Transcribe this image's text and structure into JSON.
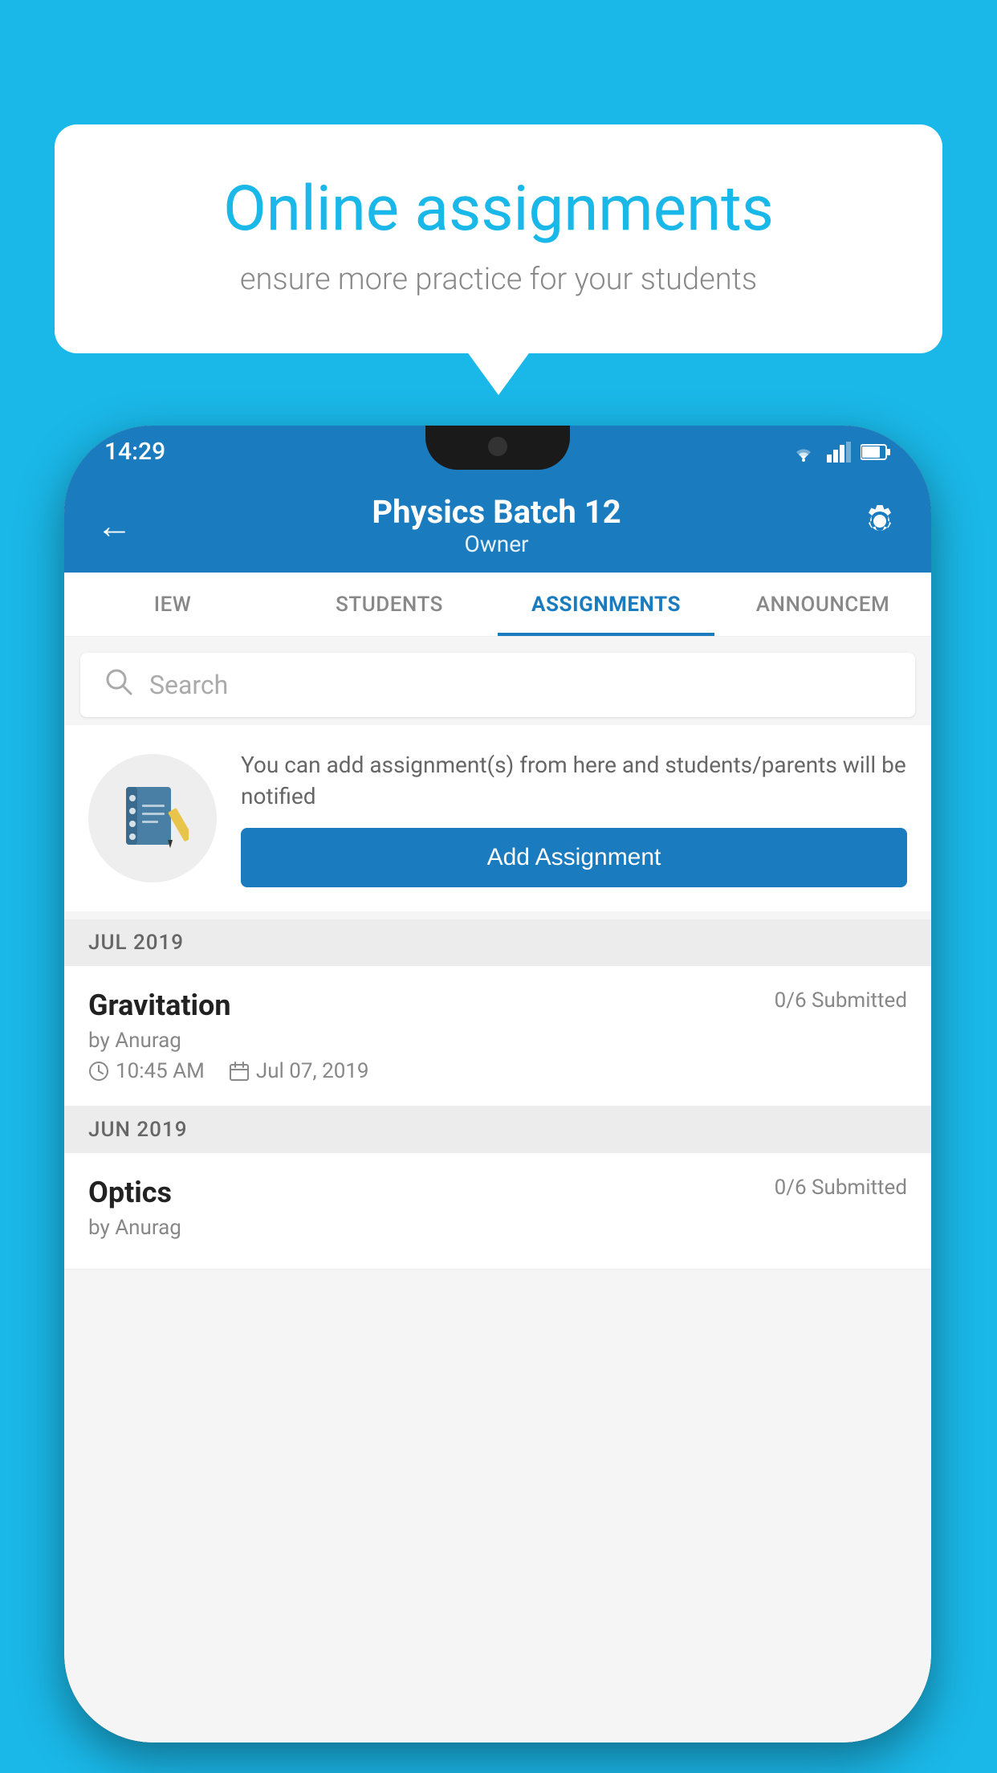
{
  "background_color": "#1ab8e8",
  "speech_bubble": {
    "title": "Online assignments",
    "subtitle": "ensure more practice for your students"
  },
  "phone": {
    "status_bar": {
      "time": "14:29"
    },
    "header": {
      "title": "Physics Batch 12",
      "subtitle": "Owner"
    },
    "tabs": [
      {
        "label": "IEW",
        "active": false
      },
      {
        "label": "STUDENTS",
        "active": false
      },
      {
        "label": "ASSIGNMENTS",
        "active": true
      },
      {
        "label": "ANNOUNCEM",
        "active": false
      }
    ],
    "search": {
      "placeholder": "Search"
    },
    "promo": {
      "description": "You can add assignment(s) from here and students/parents will be notified",
      "button_label": "Add Assignment"
    },
    "sections": [
      {
        "label": "JUL 2019",
        "assignments": [
          {
            "name": "Gravitation",
            "submitted": "0/6 Submitted",
            "author": "by Anurag",
            "time": "10:45 AM",
            "date": "Jul 07, 2019"
          }
        ]
      },
      {
        "label": "JUN 2019",
        "assignments": [
          {
            "name": "Optics",
            "submitted": "0/6 Submitted",
            "author": "by Anurag",
            "time": "",
            "date": ""
          }
        ]
      }
    ]
  }
}
